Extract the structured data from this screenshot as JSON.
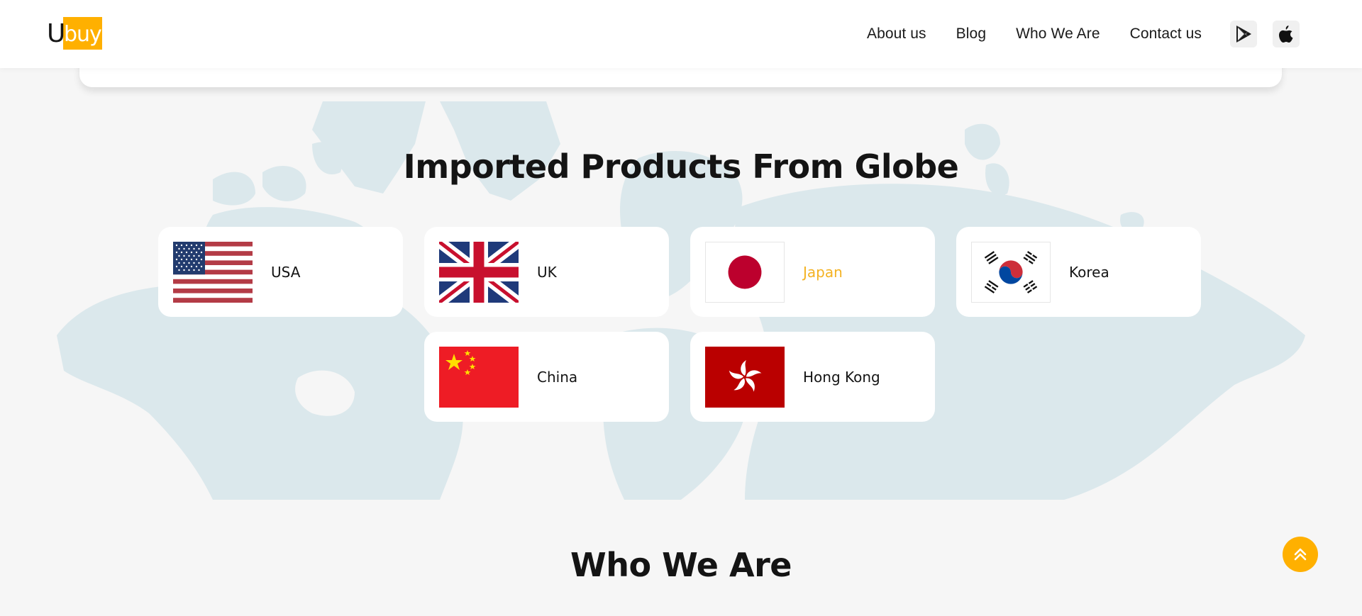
{
  "header": {
    "logo": {
      "u": "U",
      "buy": "buy",
      "brand_color": "#ffb000"
    },
    "nav": [
      {
        "label": "About us"
      },
      {
        "label": "Blog"
      },
      {
        "label": "Who We Are"
      },
      {
        "label": "Contact us"
      }
    ],
    "store_buttons": [
      {
        "icon": "google-play-icon"
      },
      {
        "icon": "apple-icon"
      }
    ]
  },
  "imported": {
    "title": "Imported Products From Globe",
    "countries": [
      {
        "name": "USA",
        "flag": "usa-flag-icon",
        "active": false
      },
      {
        "name": "UK",
        "flag": "uk-flag-icon",
        "active": false
      },
      {
        "name": "Japan",
        "flag": "japan-flag-icon",
        "active": true
      },
      {
        "name": "Korea",
        "flag": "korea-flag-icon",
        "active": false
      },
      {
        "name": "China",
        "flag": "china-flag-icon",
        "active": false
      },
      {
        "name": "Hong Kong",
        "flag": "hong-kong-flag-icon",
        "active": false
      }
    ],
    "active_color": "#f4b222"
  },
  "who_we_are": {
    "title": "Who We Are"
  },
  "scroll_top": {
    "icon": "double-chevron-up-icon",
    "color": "#ffb000"
  }
}
